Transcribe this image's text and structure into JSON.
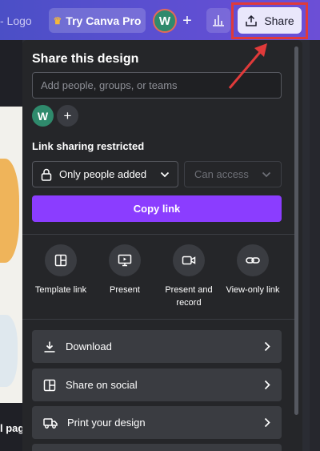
{
  "topbar": {
    "logo_text": "- Logo",
    "try_pro_label": "Try Canva Pro",
    "avatar_initial": "W",
    "add_label": "+",
    "share_label": "Share"
  },
  "canvas": {
    "caption": "l pag"
  },
  "share_panel": {
    "title": "Share this design",
    "people_placeholder": "Add people, groups, or teams",
    "avatar_initial": "W",
    "add_label": "+",
    "link_heading": "Link sharing restricted",
    "access_value": "Only people added",
    "permission_value": "Can access",
    "copy_link_label": "Copy link",
    "quick_actions": [
      {
        "label": "Template link",
        "icon": "template-icon"
      },
      {
        "label": "Present",
        "icon": "present-icon"
      },
      {
        "label": "Present and record",
        "icon": "camera-icon"
      },
      {
        "label": "View-only link",
        "icon": "link-icon"
      }
    ],
    "options": [
      {
        "label": "Download",
        "icon": "download-icon"
      },
      {
        "label": "Share on social",
        "icon": "social-icon"
      },
      {
        "label": "Print your design",
        "icon": "truck-icon"
      }
    ]
  },
  "colors": {
    "accent": "#8b3dff",
    "annotation_red": "#e03a3a"
  }
}
